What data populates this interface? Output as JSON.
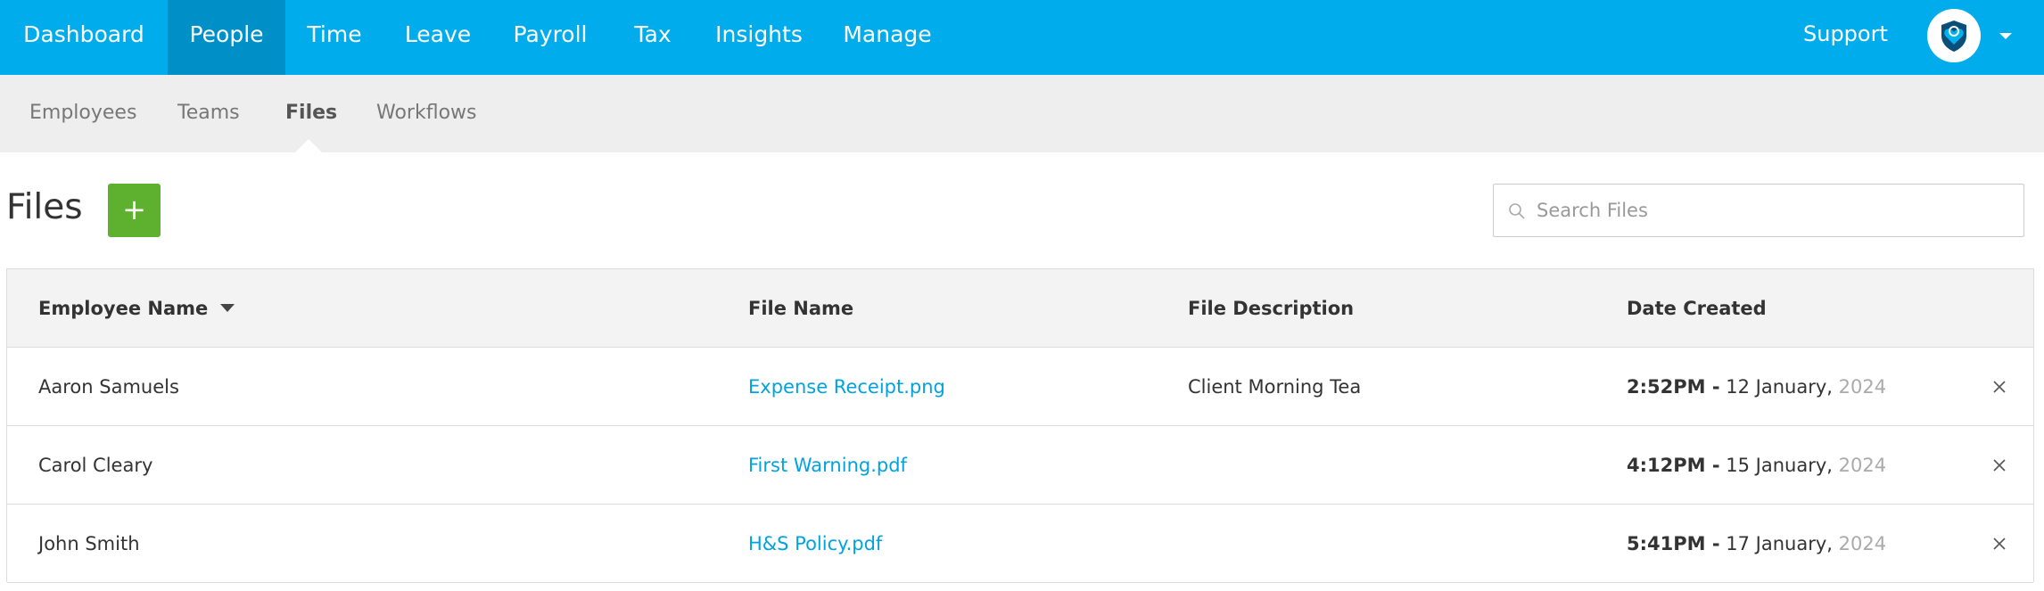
{
  "topnav": {
    "tabs": [
      {
        "label": "Dashboard"
      },
      {
        "label": "People"
      },
      {
        "label": "Time"
      },
      {
        "label": "Leave"
      },
      {
        "label": "Payroll"
      },
      {
        "label": "Tax"
      },
      {
        "label": "Insights"
      },
      {
        "label": "Manage"
      }
    ],
    "active_tab": "People",
    "support_label": "Support",
    "avatar_icon": "shield-heart-icon",
    "menu_icon": "chevron-down-icon"
  },
  "subnav": {
    "items": [
      {
        "label": "Employees"
      },
      {
        "label": "Teams"
      },
      {
        "label": "Files"
      },
      {
        "label": "Workflows"
      }
    ],
    "active_item": "Files"
  },
  "page": {
    "title": "Files",
    "add_button_label": "+",
    "search_placeholder": "Search Files",
    "search_value": ""
  },
  "table": {
    "columns": [
      {
        "label": "Employee Name",
        "sorted": "desc"
      },
      {
        "label": "File Name"
      },
      {
        "label": "File Description"
      },
      {
        "label": "Date Created"
      }
    ],
    "rows": [
      {
        "employee": "Aaron Samuels",
        "file_name": "Expense Receipt.png",
        "description": "Client Morning Tea",
        "time": "2:52PM -",
        "date": "12 January,",
        "year": "2024"
      },
      {
        "employee": "Carol Cleary",
        "file_name": "First Warning.pdf",
        "description": "",
        "time": "4:12PM -",
        "date": "15 January,",
        "year": "2024"
      },
      {
        "employee": "John Smith",
        "file_name": "H&S Policy.pdf",
        "description": "",
        "time": "5:41PM -",
        "date": "17 January,",
        "year": "2024"
      }
    ]
  },
  "colors": {
    "topnav_bg": "#00acec",
    "topnav_active_bg": "#0090c8",
    "add_button_bg": "#5db12f",
    "link": "#00a3e0"
  }
}
